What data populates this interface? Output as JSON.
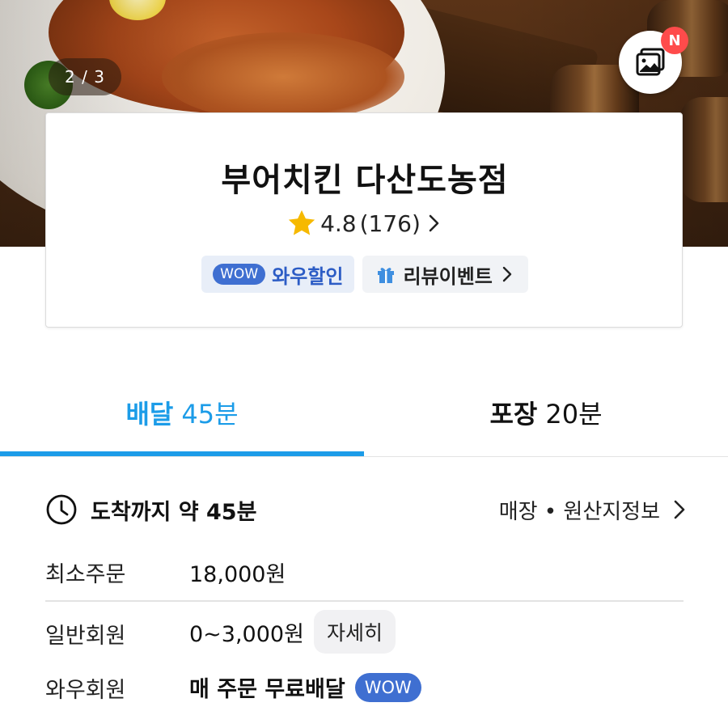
{
  "hero": {
    "photo_counter": "2 / 3",
    "new_badge": "N"
  },
  "store": {
    "name": "부어치킨 다산도농점",
    "rating": "4.8",
    "review_count": "(176)",
    "wow_tag": "WOW",
    "wow_discount_label": "와우할인",
    "review_event_label": "리뷰이벤트"
  },
  "tabs": [
    {
      "label": "배달",
      "time": "45분",
      "active": true
    },
    {
      "label": "포장",
      "time": "20분",
      "active": false
    }
  ],
  "delivery": {
    "arrival_prefix": "도착까지 약",
    "arrival_time": "45분",
    "store_info_link": "매장 • 원산지정보"
  },
  "info_rows": {
    "min_order_label": "최소주문",
    "min_order_value": "18,000원",
    "regular_member_label": "일반회원",
    "regular_member_fee": "0~3,000원",
    "detail_button": "자세히",
    "wow_member_label": "와우회원",
    "wow_member_value": "매 주문 무료배달",
    "wow_tag": "WOW"
  },
  "colors": {
    "accent_blue": "#1c9ce8",
    "wow_blue": "#3f6fd1",
    "star_yellow": "#f6b900",
    "badge_red": "#ff4b4b"
  }
}
